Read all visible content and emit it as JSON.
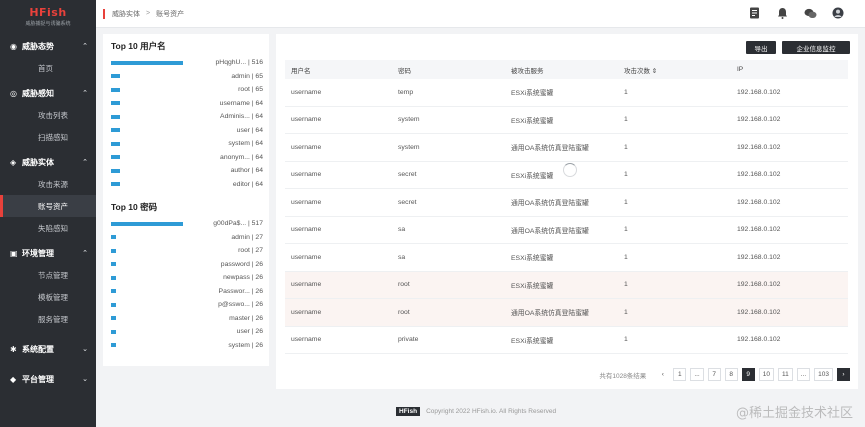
{
  "brand": {
    "title": "HFish",
    "subtitle": "威胁捕捉与诱骗系统"
  },
  "sidebar": {
    "groups": [
      {
        "title": "威胁态势",
        "icon": "dashboard-icon",
        "items": [
          {
            "label": "首页",
            "active": false
          }
        ]
      },
      {
        "title": "威胁感知",
        "icon": "radar-icon",
        "items": [
          {
            "label": "攻击列表",
            "active": false
          },
          {
            "label": "扫描感知",
            "active": false
          }
        ]
      },
      {
        "title": "威胁实体",
        "icon": "target-icon",
        "items": [
          {
            "label": "攻击来源",
            "active": false
          },
          {
            "label": "账号资产",
            "active": true
          },
          {
            "label": "失陷感知",
            "active": false
          }
        ]
      },
      {
        "title": "环境管理",
        "icon": "server-icon",
        "items": [
          {
            "label": "节点管理",
            "active": false
          },
          {
            "label": "模板管理",
            "active": false
          },
          {
            "label": "服务管理",
            "active": false
          }
        ]
      },
      {
        "title": "系统配置",
        "icon": "gear-icon",
        "items": []
      },
      {
        "title": "平台管理",
        "icon": "platform-icon",
        "items": []
      }
    ]
  },
  "breadcrumb": {
    "parent": "威胁实体",
    "separator": ">",
    "current": "账号资产"
  },
  "top_icons": [
    "document-icon",
    "bell-icon",
    "wechat-icon",
    "avatar-icon"
  ],
  "top_usernames": {
    "title": "Top 10 用户名",
    "rows": [
      {
        "label": "pHqghU... | 516",
        "value": 516
      },
      {
        "label": "admin | 65",
        "value": 65
      },
      {
        "label": "root | 65",
        "value": 65
      },
      {
        "label": "username | 64",
        "value": 64
      },
      {
        "label": "Adminis... | 64",
        "value": 64
      },
      {
        "label": "user | 64",
        "value": 64
      },
      {
        "label": "system | 64",
        "value": 64
      },
      {
        "label": "anonym... | 64",
        "value": 64
      },
      {
        "label": "author | 64",
        "value": 64
      },
      {
        "label": "editor | 64",
        "value": 64
      }
    ]
  },
  "top_passwords": {
    "title": "Top 10 密码",
    "rows": [
      {
        "label": "g00dPa$... | 517",
        "value": 517
      },
      {
        "label": "admin | 27",
        "value": 27
      },
      {
        "label": "root | 27",
        "value": 27
      },
      {
        "label": "password | 26",
        "value": 26
      },
      {
        "label": "newpass | 26",
        "value": 26
      },
      {
        "label": "Passwor... | 26",
        "value": 26
      },
      {
        "label": "p@sswo... | 26",
        "value": 26
      },
      {
        "label": "master | 26",
        "value": 26
      },
      {
        "label": "user | 26",
        "value": 26
      },
      {
        "label": "system | 26",
        "value": 26
      }
    ]
  },
  "actions": {
    "export": "导出",
    "enterprise": "企业信息监控"
  },
  "table": {
    "headers": [
      "用户名",
      "密码",
      "被攻击服务",
      "攻击次数 ⇕",
      "IP"
    ],
    "rows": [
      {
        "user": "username",
        "pass": "temp",
        "service": "ESXi系统蜜罐",
        "count": "1",
        "ip": "192.168.0.102",
        "hl": false
      },
      {
        "user": "username",
        "pass": "system",
        "service": "ESXi系统蜜罐",
        "count": "1",
        "ip": "192.168.0.102",
        "hl": false
      },
      {
        "user": "username",
        "pass": "system",
        "service": "通用OA系统仿真登陆蜜罐",
        "count": "1",
        "ip": "192.168.0.102",
        "hl": false
      },
      {
        "user": "username",
        "pass": "secret",
        "service": "ESXi系统蜜罐",
        "count": "1",
        "ip": "192.168.0.102",
        "hl": false
      },
      {
        "user": "username",
        "pass": "secret",
        "service": "通用OA系统仿真登陆蜜罐",
        "count": "1",
        "ip": "192.168.0.102",
        "hl": false
      },
      {
        "user": "username",
        "pass": "sa",
        "service": "通用OA系统仿真登陆蜜罐",
        "count": "1",
        "ip": "192.168.0.102",
        "hl": false
      },
      {
        "user": "username",
        "pass": "sa",
        "service": "ESXi系统蜜罐",
        "count": "1",
        "ip": "192.168.0.102",
        "hl": false
      },
      {
        "user": "username",
        "pass": "root",
        "service": "ESXi系统蜜罐",
        "count": "1",
        "ip": "192.168.0.102",
        "hl": true
      },
      {
        "user": "username",
        "pass": "root",
        "service": "通用OA系统仿真登陆蜜罐",
        "count": "1",
        "ip": "192.168.0.102",
        "hl": true
      },
      {
        "user": "username",
        "pass": "private",
        "service": "ESXi系统蜜罐",
        "count": "1",
        "ip": "192.168.0.102",
        "hl": false
      }
    ]
  },
  "pagination": {
    "total": "共有1028条结果",
    "prev": "‹",
    "pages": [
      "1",
      "...",
      "7",
      "8",
      "9",
      "10",
      "11",
      "...",
      "103"
    ],
    "active": "9",
    "next": "›"
  },
  "footer": {
    "badge": "HFish",
    "text": "Copyright 2022 HFish.io. All Rights Reserved"
  },
  "watermark": "@稀土掘金技术社区"
}
